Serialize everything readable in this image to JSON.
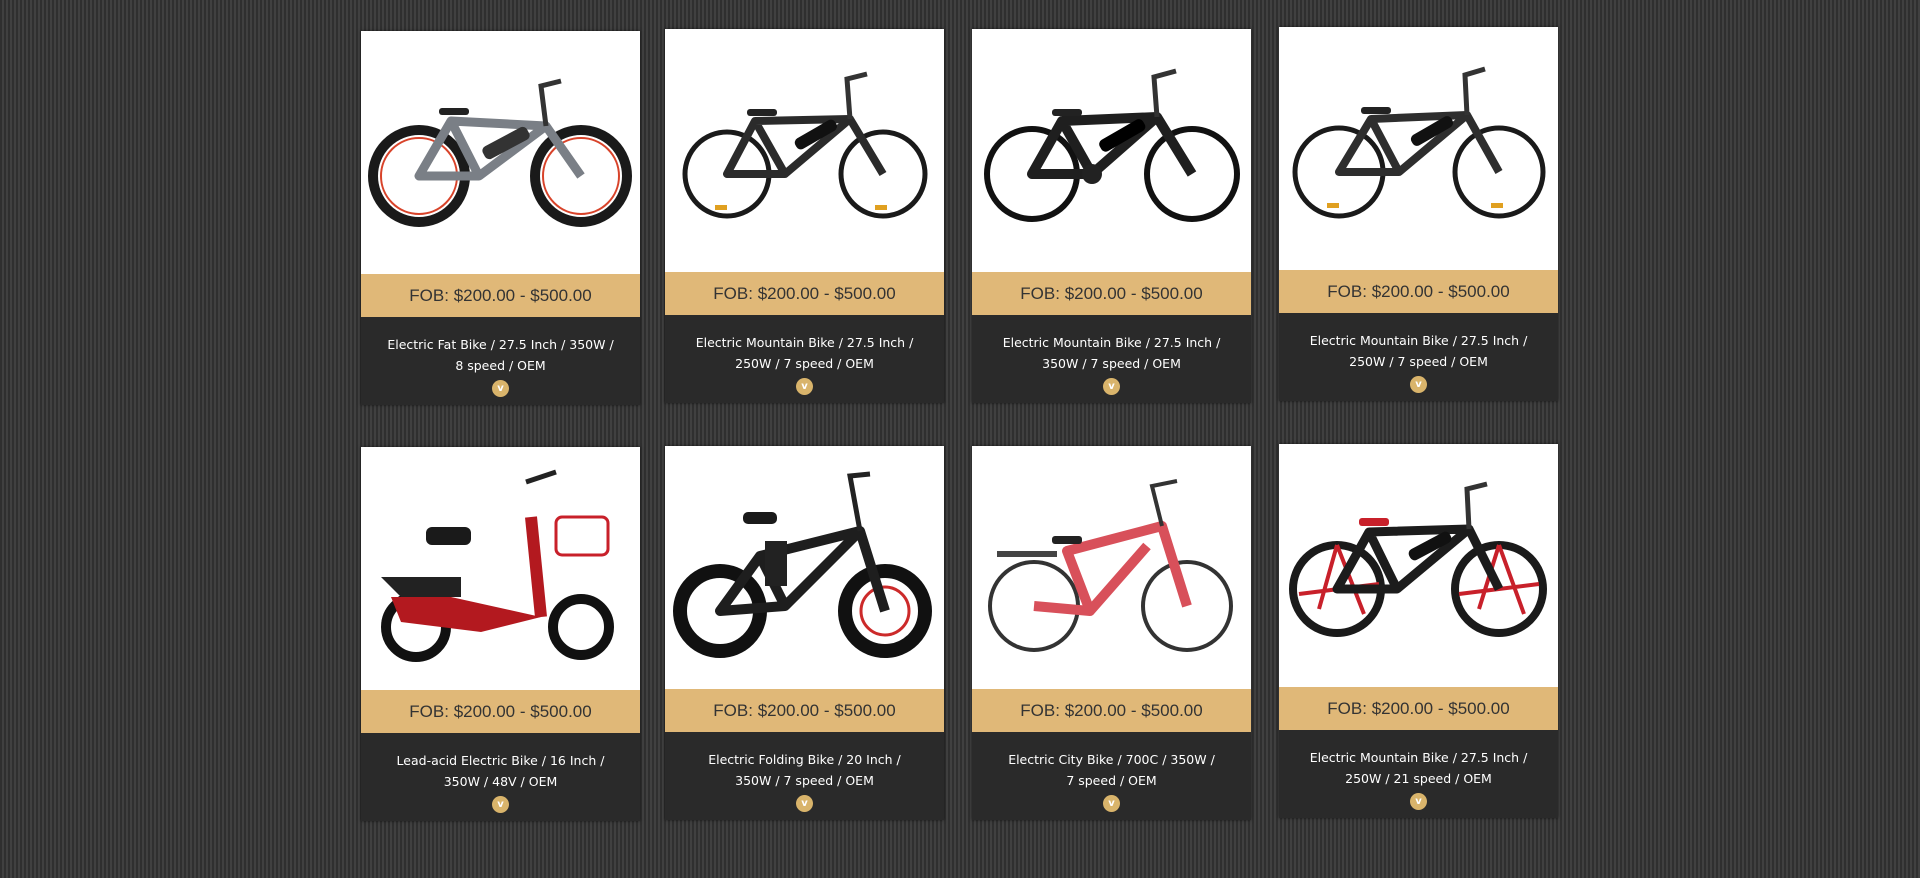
{
  "products": [
    {
      "price": "FOB: $200.00 - $500.00",
      "line1": "Electric Fat Bike / 27.5 Inch / 350W /",
      "line2": "8 speed / OEM",
      "more": "v",
      "color": "#7a7f86",
      "accent": "#d8432a"
    },
    {
      "price": "FOB: $200.00 - $500.00",
      "line1": "Electric Mountain Bike / 27.5 Inch /",
      "line2": "250W / 7 speed / OEM",
      "more": "v",
      "color": "#2b2b2b",
      "accent": "#9a9a9a"
    },
    {
      "price": "FOB: $200.00 - $500.00",
      "line1": "Electric Mountain Bike / 27.5 Inch /",
      "line2": "350W / 7 speed / OEM",
      "more": "v",
      "color": "#1f1f1f",
      "accent": "#bfbfbf"
    },
    {
      "price": "FOB: $200.00 - $500.00",
      "line1": "Electric Mountain Bike / 27.5 Inch /",
      "line2": "250W / 7 speed / OEM",
      "more": "v",
      "color": "#2e2e2e",
      "accent": "#a8a8a8"
    },
    {
      "price": "FOB: $200.00 - $500.00",
      "line1": "Lead-acid Electric Bike / 16 Inch /",
      "line2": "350W / 48V / OEM",
      "more": "v",
      "color": "#b3191f",
      "accent": "#222222"
    },
    {
      "price": "FOB: $200.00 - $500.00",
      "line1": "Electric Folding Bike / 20 Inch /",
      "line2": "350W / 7 speed / OEM",
      "more": "v",
      "color": "#1e1e1e",
      "accent": "#cc2a2a"
    },
    {
      "price": "FOB: $200.00 - $500.00",
      "line1": "Electric City Bike / 700C / 350W /",
      "line2": "7 speed / OEM",
      "more": "v",
      "color": "#d8505a",
      "accent": "#444444"
    },
    {
      "price": "FOB: $200.00 - $500.00",
      "line1": "Electric Mountain Bike / 27.5 Inch /",
      "line2": "250W / 21 speed / OEM",
      "more": "v",
      "color": "#1c1c1c",
      "accent": "#c8202a"
    }
  ]
}
